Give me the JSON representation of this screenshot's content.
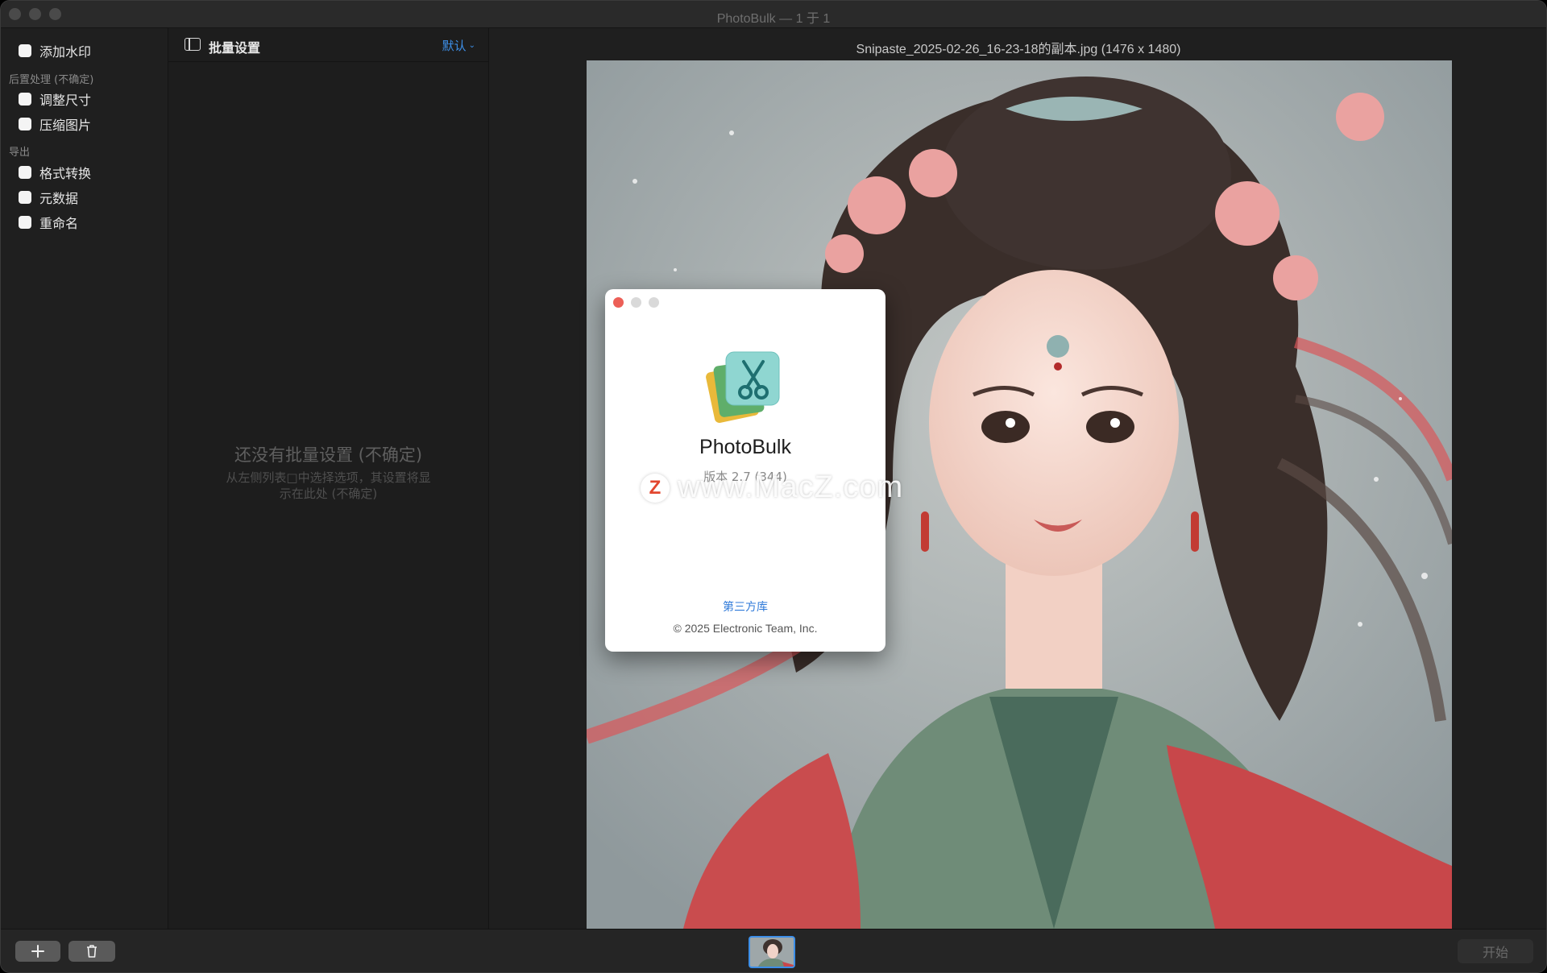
{
  "window": {
    "title": "PhotoBulk — 1 于 1"
  },
  "sidebar": {
    "watermark_label": "添加水印",
    "post_section": "后置处理 (不确定)",
    "post_items": [
      "调整尺寸",
      "压缩图片"
    ],
    "export_section": "导出",
    "export_items": [
      "格式转换",
      "元数据",
      "重命名"
    ]
  },
  "middle": {
    "title": "批量设置",
    "preset": "默认",
    "empty_title": "还没有批量设置 (不确定)",
    "empty_desc": "从左侧列表□中选择选项，其设置将显示在此处 (不确定)"
  },
  "preview": {
    "file_title": "Snipaste_2025-02-26_16-23-18的副本.jpg (1476 x 1480)"
  },
  "about": {
    "app_name": "PhotoBulk",
    "version": "版本 2.7 (344)",
    "third_party": "第三方库",
    "copyright": "© 2025 Electronic Team, Inc.",
    "close_color": "#ec5f57",
    "inactive_color": "#d9d9d9"
  },
  "watermark": {
    "letter": "Z",
    "text": "www.MacZ.com"
  },
  "bottom": {
    "add_icon": "plus-icon",
    "delete_icon": "trash-icon",
    "start_label": "开始"
  },
  "colors": {
    "accent": "#3d8fe8",
    "background": "#1e1e1e"
  }
}
